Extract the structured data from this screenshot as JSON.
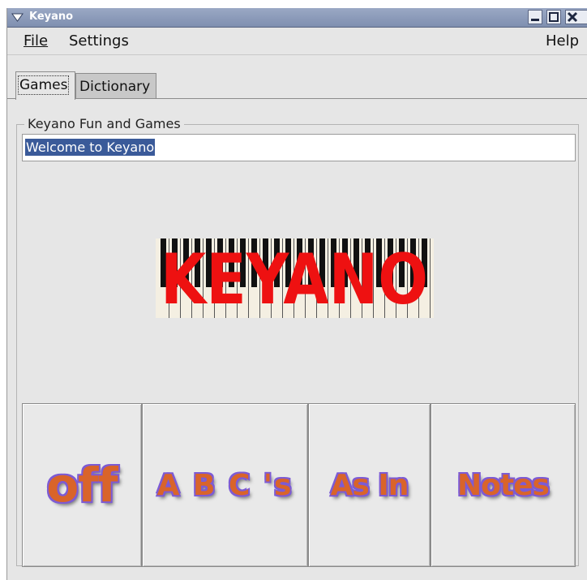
{
  "window": {
    "title": "Keyano"
  },
  "menu": {
    "file": "File",
    "settings": "Settings",
    "help": "Help"
  },
  "tabs": [
    {
      "label": "Games",
      "selected": true
    },
    {
      "label": "Dictionary",
      "selected": false
    }
  ],
  "group": {
    "label": "Keyano Fun and Games",
    "message": "Welcome to Keyano"
  },
  "logo": {
    "text": "KEYANO"
  },
  "buttons": [
    {
      "label": "off"
    },
    {
      "label": "A B C 's"
    },
    {
      "label": "As In"
    },
    {
      "label": "Notes"
    }
  ],
  "colors": {
    "titlebar": "#8a98b8",
    "selection": "#3a5a99",
    "logo_text": "#ee1111",
    "button_text": "#d9642a",
    "button_outline": "#7d5bd4"
  }
}
